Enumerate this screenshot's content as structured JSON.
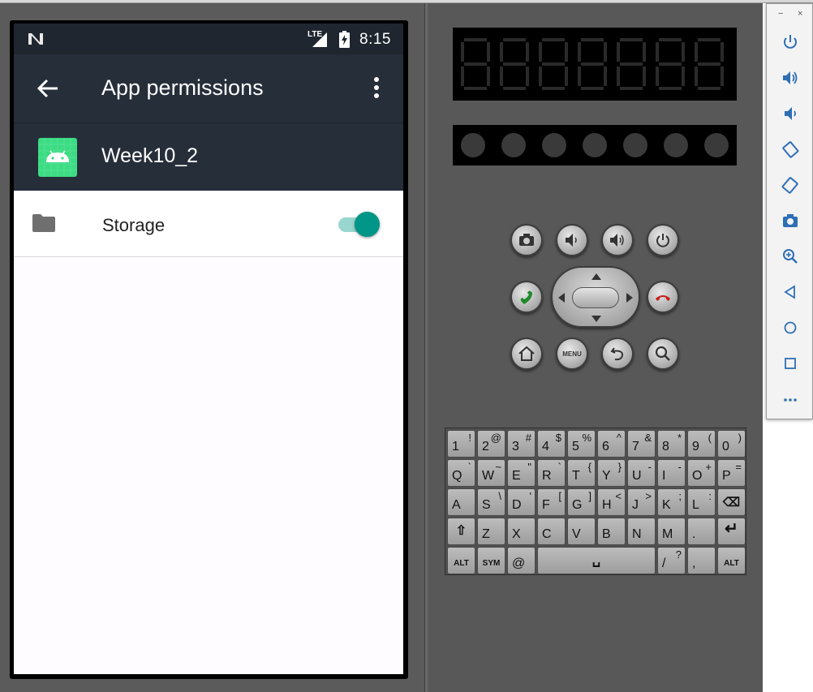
{
  "status_bar": {
    "network_label": "LTE",
    "time": "8:15"
  },
  "app_bar": {
    "title": "App permissions",
    "back_icon": "back-arrow-icon",
    "menu_icon": "overflow-menu-icon"
  },
  "app_info": {
    "name": "Week10_2",
    "icon": "android-app-icon"
  },
  "permissions": [
    {
      "label": "Storage",
      "icon": "folder-icon",
      "enabled": true
    }
  ],
  "colors": {
    "accent": "#009687",
    "app_bar": "#262e3a",
    "status_bar": "#1f262f"
  },
  "emulator_keys": {
    "phone_buttons": [
      "camera",
      "volume-down",
      "volume-up",
      "power",
      "call",
      "end-call",
      "home",
      "MENU",
      "back",
      "search"
    ],
    "menu_label": "MENU",
    "rows": [
      [
        [
          "1",
          "!"
        ],
        [
          "2",
          "@"
        ],
        [
          "3",
          "#"
        ],
        [
          "4",
          "$"
        ],
        [
          "5",
          "%"
        ],
        [
          "6",
          "^"
        ],
        [
          "7",
          "&"
        ],
        [
          "8",
          "*"
        ],
        [
          "9",
          "("
        ],
        [
          "0",
          ")"
        ]
      ],
      [
        [
          "Q",
          "`"
        ],
        [
          "W",
          "~"
        ],
        [
          "E",
          "\""
        ],
        [
          "R",
          "`"
        ],
        [
          "T",
          "{"
        ],
        [
          "Y",
          "}"
        ],
        [
          "U",
          "-"
        ],
        [
          "I",
          "-"
        ],
        [
          "O",
          "+"
        ],
        [
          "P",
          "="
        ]
      ],
      [
        [
          "A",
          ""
        ],
        [
          "S",
          "\\"
        ],
        [
          "D",
          "'"
        ],
        [
          "F",
          "["
        ],
        [
          "G",
          "]"
        ],
        [
          "H",
          "<"
        ],
        [
          "J",
          ">"
        ],
        [
          "K",
          ";"
        ],
        [
          "L",
          ":"
        ],
        [
          "DEL",
          ""
        ]
      ],
      [
        [
          "SHIFT",
          ""
        ],
        [
          "Z",
          ""
        ],
        [
          "X",
          ""
        ],
        [
          "C",
          ""
        ],
        [
          "V",
          ""
        ],
        [
          "B",
          ""
        ],
        [
          "N",
          ""
        ],
        [
          "M",
          ""
        ],
        [
          ".",
          ""
        ],
        [
          "ENTER",
          ""
        ]
      ],
      [
        [
          "ALT",
          ""
        ],
        [
          "SYM",
          ""
        ],
        [
          "@",
          ""
        ],
        [
          "SPACE",
          ""
        ],
        [
          "/",
          "?"
        ],
        [
          ",",
          ""
        ],
        [
          "ALT",
          ""
        ]
      ]
    ]
  },
  "side_toolbar": {
    "window_controls": [
      "−",
      "×"
    ],
    "buttons": [
      "power-icon",
      "volume-up-icon",
      "volume-down-icon",
      "rotate-left-icon",
      "rotate-right-icon",
      "screenshot-icon",
      "zoom-icon",
      "back-icon",
      "home-icon",
      "overview-icon",
      "more-icon"
    ]
  }
}
